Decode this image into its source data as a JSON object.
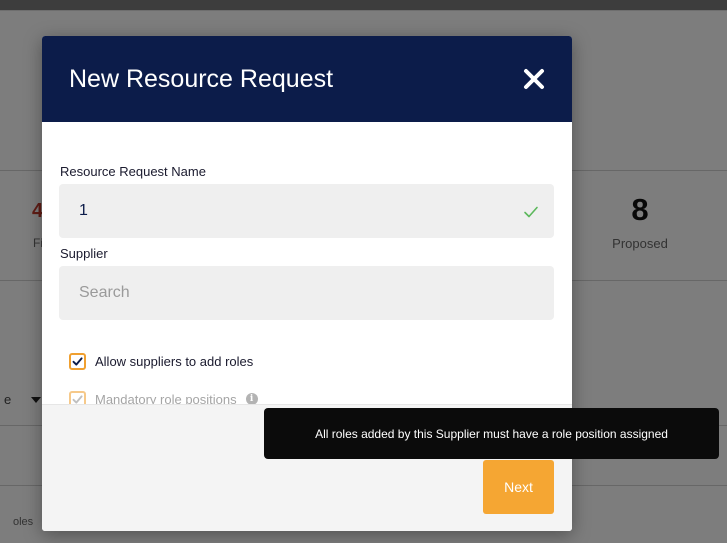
{
  "background": {
    "stat_value": "8",
    "stat_label": "Proposed",
    "fragment_1": "4",
    "fragment_2": "Fi",
    "fragment_3": "oles",
    "fragment_4": "e"
  },
  "modal": {
    "title": "New Resource Request",
    "close_icon": "close-x-icon",
    "name_field": {
      "label": "Resource Request Name",
      "value": "1",
      "valid_icon": "check-icon"
    },
    "supplier_field": {
      "label": "Supplier",
      "value": "",
      "placeholder": "Search"
    },
    "checkboxes": [
      {
        "label": "Allow suppliers to add roles",
        "checked": true,
        "disabled": false
      },
      {
        "label": "Mandatory role positions",
        "checked": true,
        "disabled": true
      }
    ],
    "next_label": "Next"
  },
  "tooltip": {
    "text": "All roles added by this Supplier must have a role position assigned"
  },
  "colors": {
    "header": "#0c1c4a",
    "accent": "#f5a633",
    "valid": "#5cb85c"
  }
}
